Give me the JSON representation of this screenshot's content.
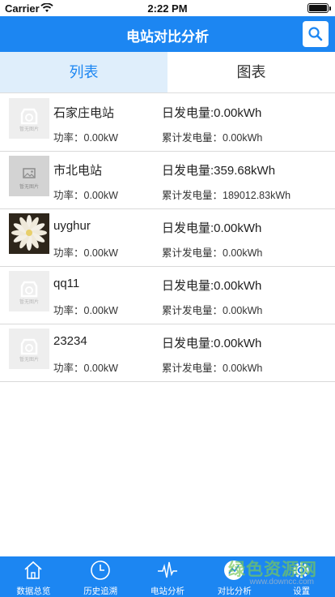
{
  "status_bar": {
    "carrier": "Carrier",
    "time": "2:22 PM",
    "battery_level": 1.0
  },
  "nav": {
    "title": "电站对比分析",
    "search_icon": "search-icon"
  },
  "tabs": [
    {
      "label": "列表",
      "active": true
    },
    {
      "label": "图表",
      "active": false
    }
  ],
  "stations": [
    {
      "name": "石家庄电站",
      "daily": "日发电量:0.00kWh",
      "power": "功率：0.00kW",
      "total": "累计发电量：0.00kWh",
      "thumb": "placeholder",
      "thumb_text": "暂无图片"
    },
    {
      "name": "市北电站",
      "daily": "日发电量:359.68kWh",
      "power": "功率：0.00kW",
      "total": "累计发电量：189012.83kWh",
      "thumb": "placeholder-gray",
      "thumb_text": "暂无图片"
    },
    {
      "name": "uyghur",
      "daily": "日发电量:0.00kWh",
      "power": "功率：0.00kW",
      "total": "累计发电量：0.00kWh",
      "thumb": "flower-photo",
      "thumb_text": ""
    },
    {
      "name": "qq11",
      "daily": "日发电量:0.00kWh",
      "power": "功率：0.00kW",
      "total": "累计发电量：0.00kWh",
      "thumb": "placeholder",
      "thumb_text": "暂无图片"
    },
    {
      "name": "23234",
      "daily": "日发电量:0.00kWh",
      "power": "功率：0.00kW",
      "total": "累计发电量：0.00kWh",
      "thumb": "placeholder",
      "thumb_text": "暂无图片"
    }
  ],
  "tab_bar": [
    {
      "label": "数据总览",
      "icon": "home-icon"
    },
    {
      "label": "历史追溯",
      "icon": "clock-icon"
    },
    {
      "label": "电站分析",
      "icon": "pulse-icon"
    },
    {
      "label": "对比分析",
      "icon": "compare-icon",
      "active": true
    },
    {
      "label": "设置",
      "icon": "gear-icon"
    }
  ],
  "watermark": {
    "text": "绿色资源网",
    "url": "www.downcc.com"
  },
  "colors": {
    "primary": "#1c86f2",
    "tab_active_bg": "#dfeefb",
    "watermark": "#78c85a"
  }
}
